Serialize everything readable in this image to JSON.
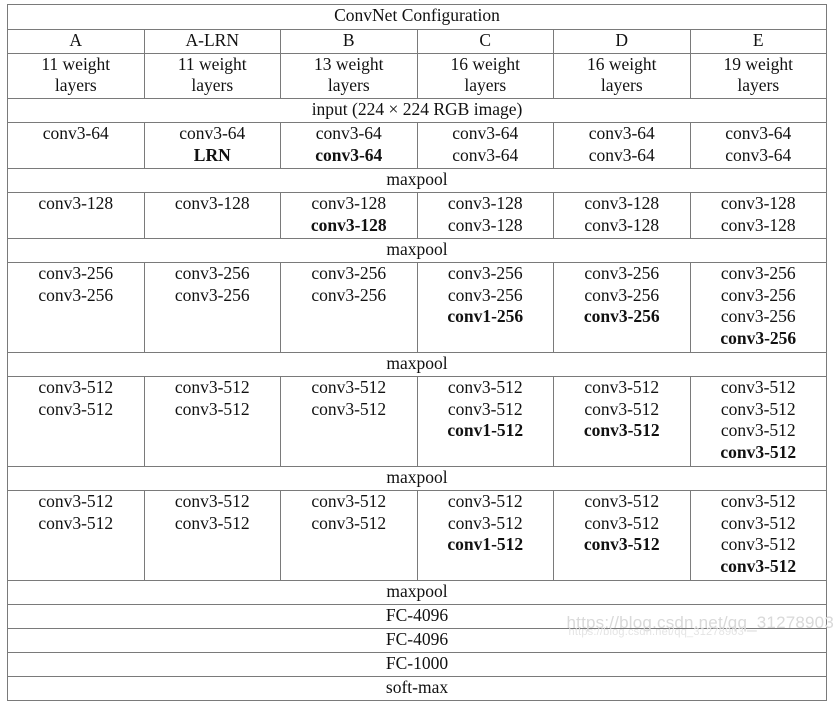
{
  "table": {
    "title": "ConvNet Configuration",
    "columns": [
      {
        "letter": "A",
        "weights": "11 weight\nlayers"
      },
      {
        "letter": "A-LRN",
        "weights": "11 weight\nlayers"
      },
      {
        "letter": "B",
        "weights": "13 weight\nlayers"
      },
      {
        "letter": "C",
        "weights": "16 weight\nlayers"
      },
      {
        "letter": "D",
        "weights": "16 weight\nlayers"
      },
      {
        "letter": "E",
        "weights": "19 weight\nlayers"
      }
    ],
    "input_row": "input (224 × 224 RGB image)",
    "maxpool_label": "maxpool",
    "blocks": [
      {
        "id": "block-64",
        "cells": [
          [
            {
              "text": "conv3-64",
              "bold": false
            }
          ],
          [
            {
              "text": "conv3-64",
              "bold": false
            },
            {
              "text": "LRN",
              "bold": true
            }
          ],
          [
            {
              "text": "conv3-64",
              "bold": false
            },
            {
              "text": "conv3-64",
              "bold": true
            }
          ],
          [
            {
              "text": "conv3-64",
              "bold": false
            },
            {
              "text": "conv3-64",
              "bold": false
            }
          ],
          [
            {
              "text": "conv3-64",
              "bold": false
            },
            {
              "text": "conv3-64",
              "bold": false
            }
          ],
          [
            {
              "text": "conv3-64",
              "bold": false
            },
            {
              "text": "conv3-64",
              "bold": false
            }
          ]
        ]
      },
      {
        "id": "block-128",
        "cells": [
          [
            {
              "text": "conv3-128",
              "bold": false
            }
          ],
          [
            {
              "text": "conv3-128",
              "bold": false
            }
          ],
          [
            {
              "text": "conv3-128",
              "bold": false
            },
            {
              "text": "conv3-128",
              "bold": true
            }
          ],
          [
            {
              "text": "conv3-128",
              "bold": false
            },
            {
              "text": "conv3-128",
              "bold": false
            }
          ],
          [
            {
              "text": "conv3-128",
              "bold": false
            },
            {
              "text": "conv3-128",
              "bold": false
            }
          ],
          [
            {
              "text": "conv3-128",
              "bold": false
            },
            {
              "text": "conv3-128",
              "bold": false
            }
          ]
        ]
      },
      {
        "id": "block-256",
        "cells": [
          [
            {
              "text": "conv3-256",
              "bold": false
            },
            {
              "text": "conv3-256",
              "bold": false
            }
          ],
          [
            {
              "text": "conv3-256",
              "bold": false
            },
            {
              "text": "conv3-256",
              "bold": false
            }
          ],
          [
            {
              "text": "conv3-256",
              "bold": false
            },
            {
              "text": "conv3-256",
              "bold": false
            }
          ],
          [
            {
              "text": "conv3-256",
              "bold": false
            },
            {
              "text": "conv3-256",
              "bold": false
            },
            {
              "text": "conv1-256",
              "bold": true
            }
          ],
          [
            {
              "text": "conv3-256",
              "bold": false
            },
            {
              "text": "conv3-256",
              "bold": false
            },
            {
              "text": "conv3-256",
              "bold": true
            }
          ],
          [
            {
              "text": "conv3-256",
              "bold": false
            },
            {
              "text": "conv3-256",
              "bold": false
            },
            {
              "text": "conv3-256",
              "bold": false
            },
            {
              "text": "conv3-256",
              "bold": true
            }
          ]
        ]
      },
      {
        "id": "block-512a",
        "cells": [
          [
            {
              "text": "conv3-512",
              "bold": false
            },
            {
              "text": "conv3-512",
              "bold": false
            }
          ],
          [
            {
              "text": "conv3-512",
              "bold": false
            },
            {
              "text": "conv3-512",
              "bold": false
            }
          ],
          [
            {
              "text": "conv3-512",
              "bold": false
            },
            {
              "text": "conv3-512",
              "bold": false
            }
          ],
          [
            {
              "text": "conv3-512",
              "bold": false
            },
            {
              "text": "conv3-512",
              "bold": false
            },
            {
              "text": "conv1-512",
              "bold": true
            }
          ],
          [
            {
              "text": "conv3-512",
              "bold": false
            },
            {
              "text": "conv3-512",
              "bold": false
            },
            {
              "text": "conv3-512",
              "bold": true
            }
          ],
          [
            {
              "text": "conv3-512",
              "bold": false
            },
            {
              "text": "conv3-512",
              "bold": false
            },
            {
              "text": "conv3-512",
              "bold": false
            },
            {
              "text": "conv3-512",
              "bold": true
            }
          ]
        ]
      },
      {
        "id": "block-512b",
        "cells": [
          [
            {
              "text": "conv3-512",
              "bold": false
            },
            {
              "text": "conv3-512",
              "bold": false
            }
          ],
          [
            {
              "text": "conv3-512",
              "bold": false
            },
            {
              "text": "conv3-512",
              "bold": false
            }
          ],
          [
            {
              "text": "conv3-512",
              "bold": false
            },
            {
              "text": "conv3-512",
              "bold": false
            }
          ],
          [
            {
              "text": "conv3-512",
              "bold": false
            },
            {
              "text": "conv3-512",
              "bold": false
            },
            {
              "text": "conv1-512",
              "bold": true
            }
          ],
          [
            {
              "text": "conv3-512",
              "bold": false
            },
            {
              "text": "conv3-512",
              "bold": false
            },
            {
              "text": "conv3-512",
              "bold": true
            }
          ],
          [
            {
              "text": "conv3-512",
              "bold": false
            },
            {
              "text": "conv3-512",
              "bold": false
            },
            {
              "text": "conv3-512",
              "bold": false
            },
            {
              "text": "conv3-512",
              "bold": true
            }
          ]
        ]
      }
    ],
    "footer_rows": [
      "FC-4096",
      "FC-4096",
      "FC-1000",
      "soft-max"
    ]
  },
  "watermark": {
    "primary": "https://blog.csdn.net/qq_31278903",
    "secondary": "https://blog.csdn.net/qq_31278903"
  },
  "colors": {
    "border": "#7a7a7a",
    "text": "#111111",
    "background": "#ffffff",
    "watermark": "#d9d9d9"
  }
}
